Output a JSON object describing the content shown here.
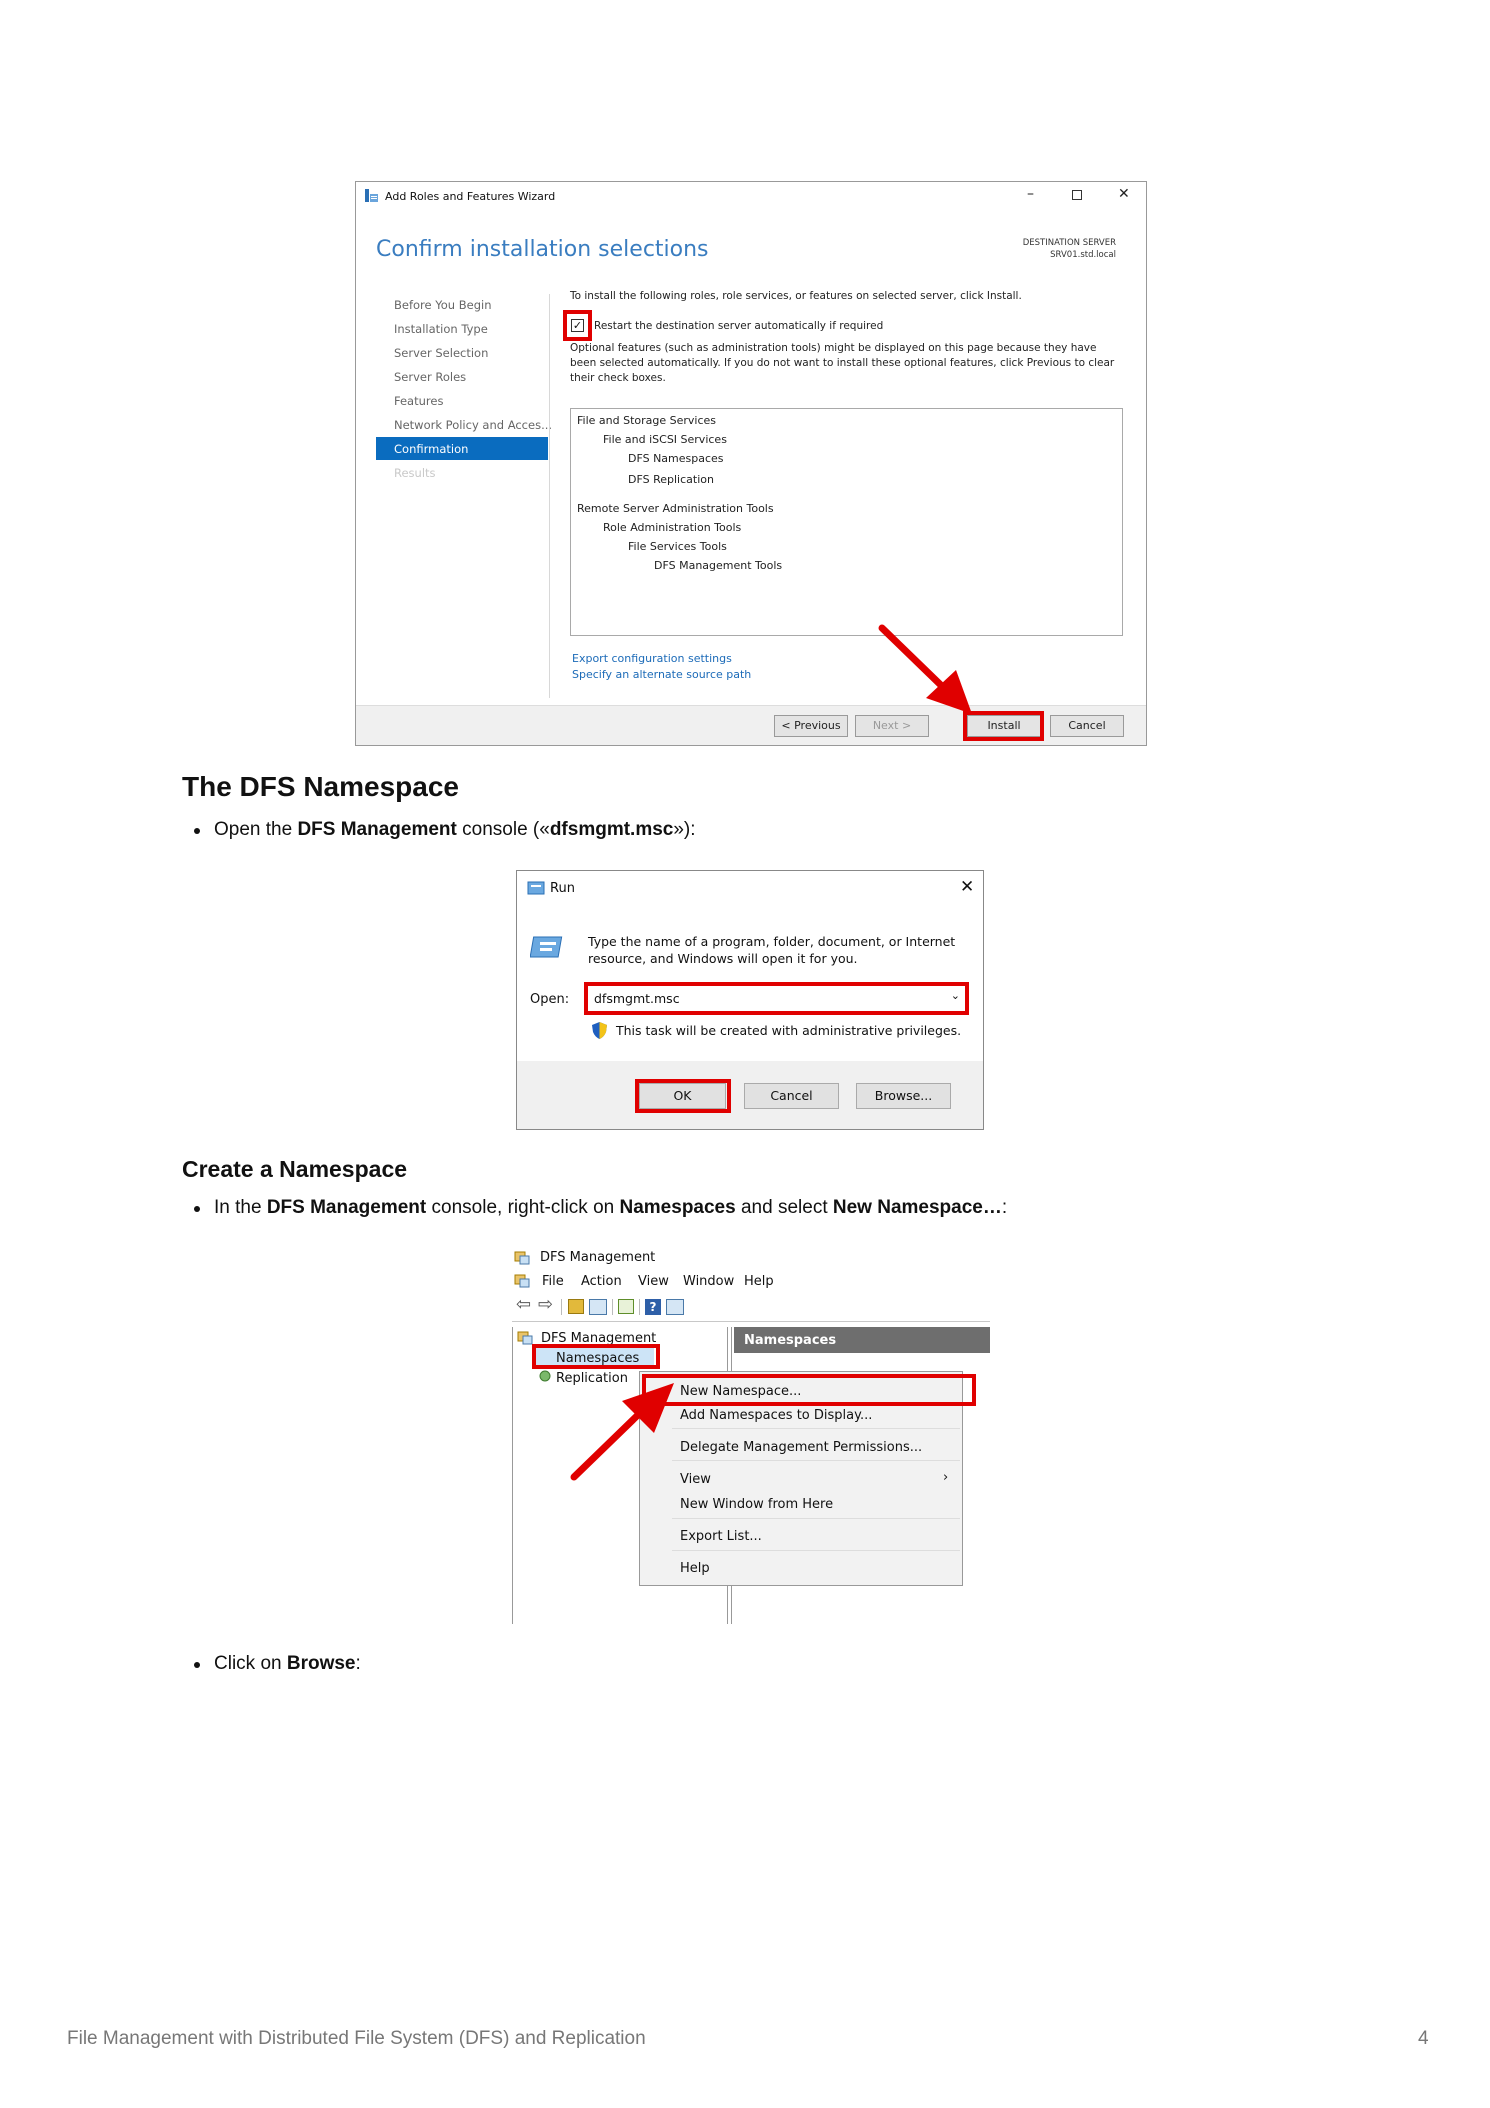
{
  "wizard": {
    "window_title": "Add Roles and Features Wizard",
    "heading": "Confirm installation selections",
    "destination_label": "DESTINATION SERVER",
    "destination_server": "SRV01.std.local",
    "steps": [
      "Before You Begin",
      "Installation Type",
      "Server Selection",
      "Server Roles",
      "Features",
      "Network Policy and Acces...",
      "Confirmation",
      "Results"
    ],
    "intro": "To install the following roles, role services, or features on selected server, click Install.",
    "restart_label": "Restart the destination server automatically if required",
    "optional_line1": "Optional features (such as administration tools) might be displayed on this page because they have",
    "optional_line2": "been selected automatically. If you do not want to install these optional features, click Previous to clear",
    "optional_line3": "their check boxes.",
    "features": [
      "File and Storage Services",
      "File and iSCSI Services",
      "DFS Namespaces",
      "DFS Replication",
      "Remote Server Administration Tools",
      "Role Administration Tools",
      "File Services Tools",
      "DFS Management Tools"
    ],
    "link_export": "Export configuration settings",
    "link_alternate": "Specify an alternate source path",
    "btn_previous": "< Previous",
    "btn_next": "Next >",
    "btn_install": "Install",
    "btn_cancel": "Cancel"
  },
  "section_title": "The DFS Namespace",
  "bullet1": {
    "pre": "Open the ",
    "bold1": "DFS Management",
    "mid": " console («",
    "bold2": "dfsmgmt.msc",
    "post": "»):"
  },
  "run": {
    "title": "Run",
    "desc_line1": "Type the name of a program, folder, document, or Internet",
    "desc_line2": "resource, and Windows will open it for you.",
    "open_label": "Open:",
    "open_value": "dfsmgmt.msc",
    "privilege_note": "This task will be created with administrative privileges.",
    "btn_ok": "OK",
    "btn_cancel": "Cancel",
    "btn_browse": "Browse..."
  },
  "subsection_title": "Create a Namespace",
  "bullet2": {
    "pre": "In the ",
    "bold1": "DFS Management",
    "mid1": " console, right-click on ",
    "bold2": "Namespaces",
    "mid2": " and select ",
    "bold3": "New Namespace…",
    "post": ":"
  },
  "dfs": {
    "window_title": "DFS Management",
    "menu": [
      "File",
      "Action",
      "View",
      "Window",
      "Help"
    ],
    "tree_root": "DFS Management",
    "tree_namespaces": "Namespaces",
    "tree_replication": "Replication",
    "pane_header": "Namespaces",
    "context_menu": [
      "New Namespace...",
      "Add Namespaces to Display...",
      "Delegate Management Permissions...",
      "View",
      "New Window from Here",
      "Export List...",
      "Help"
    ]
  },
  "bullet3": {
    "pre": "Click on ",
    "bold1": "Browse",
    "post": ":"
  },
  "footer": {
    "title": "File Management with Distributed File System (DFS) and Replication",
    "page": "4"
  },
  "colors": {
    "accent_red": "#e00000",
    "wizard_heading": "#3a7dc0",
    "selection_blue": "#0a6cbf",
    "link_blue": "#1c6bb8"
  }
}
